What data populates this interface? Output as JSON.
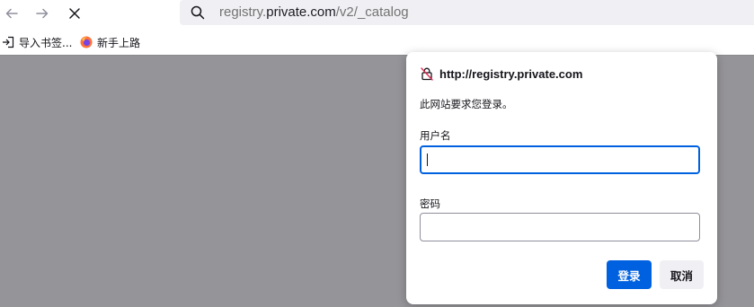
{
  "browser": {
    "nav": {
      "back_icon": "arrow-left-icon",
      "forward_icon": "arrow-right-icon",
      "stop_icon": "close-icon"
    },
    "urlbar": {
      "url_prefix": "registry.",
      "url_host": "private.com",
      "url_path": "/v2/_catalog",
      "search_icon": "search-icon"
    },
    "bookmarks": [
      {
        "label": "导入书签...",
        "icon": "import-icon"
      },
      {
        "label": "新手上路",
        "icon": "firefox-icon"
      }
    ]
  },
  "auth_dialog": {
    "title": "http://registry.private.com",
    "title_icon": "lock-crossed-icon",
    "message": "此网站要求您登录。",
    "username_label": "用户名",
    "username_value": "",
    "password_label": "密码",
    "password_value": "",
    "login_button": "登录",
    "cancel_button": "取消"
  },
  "colors": {
    "accent": "#0061e0",
    "overlay": "#959498",
    "urlbar_bg": "#f0f0f4"
  }
}
